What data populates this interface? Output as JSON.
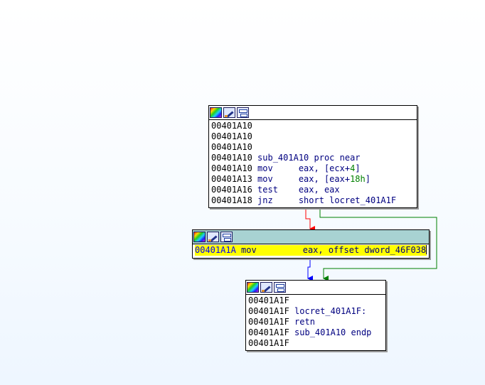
{
  "graph": {
    "blocks": [
      {
        "id": "block-entry",
        "selected": false,
        "lines": [
          {
            "addr": "00401A10",
            "parts": []
          },
          {
            "addr": "00401A10",
            "parts": []
          },
          {
            "addr": "00401A10",
            "parts": []
          },
          {
            "addr": "00401A10",
            "parts": [
              {
                "t": "sub_401A10 proc near",
                "c": "kw"
              }
            ]
          },
          {
            "addr": "00401A10",
            "parts": [
              {
                "t": "mov     ",
                "c": "kw"
              },
              {
                "t": "eax, [ecx+",
                "c": "reg"
              },
              {
                "t": "4",
                "c": "num"
              },
              {
                "t": "]",
                "c": "reg"
              }
            ]
          },
          {
            "addr": "00401A13",
            "parts": [
              {
                "t": "mov     ",
                "c": "kw"
              },
              {
                "t": "eax, [eax+",
                "c": "reg"
              },
              {
                "t": "18h",
                "c": "num"
              },
              {
                "t": "]",
                "c": "reg"
              }
            ]
          },
          {
            "addr": "00401A16",
            "parts": [
              {
                "t": "test    ",
                "c": "kw"
              },
              {
                "t": "eax, eax",
                "c": "reg"
              }
            ]
          },
          {
            "addr": "00401A18",
            "parts": [
              {
                "t": "jnz     ",
                "c": "kw"
              },
              {
                "t": "short locret_401A1F",
                "c": "reg"
              }
            ]
          }
        ]
      },
      {
        "id": "block-mov",
        "selected": true,
        "lines": [
          {
            "addr": "00401A1A",
            "current": true,
            "caret": true,
            "parts": [
              {
                "t": "mov         ",
                "c": "kw"
              },
              {
                "t": "eax, offset dword_46F038",
                "c": "reg"
              }
            ]
          }
        ]
      },
      {
        "id": "block-ret",
        "selected": false,
        "lines": [
          {
            "addr": "00401A1F",
            "parts": []
          },
          {
            "addr": "00401A1F",
            "parts": [
              {
                "t": "locret_401A1F:",
                "c": "kw"
              }
            ]
          },
          {
            "addr": "00401A1F",
            "parts": [
              {
                "t": "retn",
                "c": "kw"
              }
            ]
          },
          {
            "addr": "00401A1F",
            "parts": [
              {
                "t": "sub_401A10 endp",
                "c": "kw"
              }
            ]
          },
          {
            "addr": "00401A1F",
            "parts": []
          }
        ]
      }
    ],
    "edges": [
      {
        "id": "edge-false",
        "kind": "false",
        "color": "#ff0000"
      },
      {
        "id": "edge-true",
        "kind": "true",
        "color": "#008000"
      },
      {
        "id": "edge-flow",
        "kind": "flow",
        "color": "#0000ff"
      }
    ],
    "header_icons": [
      "color-palette-icon",
      "rename-pencil-icon",
      "graph-overview-icon"
    ]
  }
}
